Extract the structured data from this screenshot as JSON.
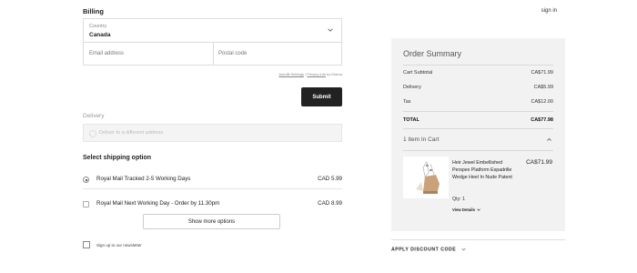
{
  "header": {
    "sign_in": "sign in"
  },
  "billing": {
    "title": "Billing",
    "country_label": "Country",
    "country_value": "Canada",
    "email_placeholder": "Email address",
    "postal_placeholder": "Postal code",
    "autofill_link": "Autofill Settings",
    "autofill_sep": " / ",
    "privacy_link": "Privacy info",
    "autofill_by": " by Klarna",
    "submit_label": "Submit"
  },
  "delivery": {
    "title": "Delivery",
    "option": "Deliver to a different address"
  },
  "shipping": {
    "title": "Select shipping option",
    "options": [
      {
        "label": "Royal Mail Tracked 2-5 Working Days",
        "price": "CAD 5.99",
        "selected": true
      },
      {
        "label": "Royal Mail Next Working Day - Order by 11.30pm",
        "price": "CAD 8.99",
        "selected": false
      }
    ],
    "more_label": "Show more options"
  },
  "newsletter": {
    "label": "Sign up to our newsletter"
  },
  "order_summary": {
    "title": "Order Summary",
    "rows": [
      {
        "label": "Cart Subtotal",
        "value": "CA$71.99"
      },
      {
        "label": "Delivery",
        "value": "CA$5.99"
      },
      {
        "label": "Tax",
        "value": "CA$12.00"
      }
    ],
    "total_label": "TOTAL",
    "total_value": "CA$77.98",
    "items_heading": "1 Item In Cart",
    "item": {
      "name": "Heir Jewel Embellished Perspex Platform Espadrille Wedge Heel In Nude Patent",
      "price": "CA$71.99",
      "qty": "Qty: 1",
      "view_details": "View Details"
    }
  },
  "discount": {
    "label": "APPLY DISCOUNT CODE"
  },
  "colors": {
    "accent": "#222222",
    "panel": "#f2f2f2"
  }
}
